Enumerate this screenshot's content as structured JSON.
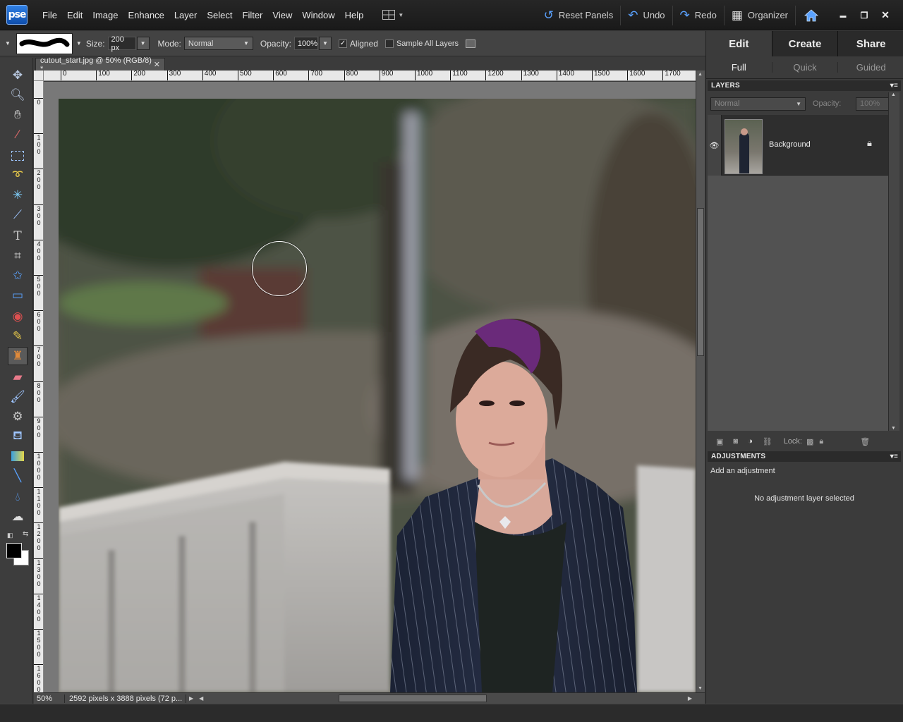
{
  "app": {
    "logo": "pse"
  },
  "menu": [
    "File",
    "Edit",
    "Image",
    "Enhance",
    "Layer",
    "Select",
    "Filter",
    "View",
    "Window",
    "Help"
  ],
  "menu_right": {
    "reset_panels": "Reset Panels",
    "undo": "Undo",
    "redo": "Redo",
    "organizer": "Organizer"
  },
  "window_buttons": {
    "minimize": "▬",
    "restore": "❐",
    "close": "✕"
  },
  "options": {
    "size_label": "Size:",
    "size_value": "200 px",
    "mode_label": "Mode:",
    "mode_value": "Normal",
    "opacity_label": "Opacity:",
    "opacity_value": "100%",
    "aligned_label": "Aligned",
    "aligned_checked": true,
    "sample_all_layers_label": "Sample All Layers",
    "sample_all_layers_checked": false
  },
  "document": {
    "tab_title": "cutout_start.jpg @ 50% (RGB/8) *",
    "hruler_ticks": [
      "0",
      "100",
      "200",
      "300",
      "400",
      "500",
      "600",
      "700",
      "800",
      "900",
      "1000",
      "1100",
      "1200",
      "1300",
      "1400",
      "1500",
      "1600",
      "1700"
    ],
    "vruler_ticks": [
      "0",
      "1 0 0",
      "2 0 0",
      "3 0 0",
      "4 0 0",
      "5 0 0",
      "6 0 0",
      "7 0 0",
      "8 0 0",
      "9 0 0",
      "1 0 0 0",
      "1 1 0 0",
      "1 2 0 0",
      "1 3 0 0",
      "1 4 0 0",
      "1 5 0 0",
      "1 6 0 0"
    ]
  },
  "status": {
    "zoom": "50%",
    "info": "2592 pixels x 3888 pixels (72 p..."
  },
  "right_panel": {
    "mode_tabs": [
      "Edit",
      "Create",
      "Share"
    ],
    "active_mode": "Edit",
    "sub_tabs": [
      "Full",
      "Quick",
      "Guided"
    ],
    "active_sub": "Full",
    "layers": {
      "title": "LAYERS",
      "blend_mode": "Normal",
      "opacity_label": "Opacity:",
      "opacity_value": "100%",
      "lock_label": "Lock:",
      "items": [
        {
          "name": "Background",
          "locked": true,
          "visible": true
        }
      ]
    },
    "adjustments": {
      "title": "ADJUSTMENTS",
      "subtitle": "Add an adjustment",
      "empty_text": "No adjustment layer selected"
    }
  },
  "colors": {
    "accent": "#5aa2ff",
    "panel_bg": "#3b3b3b",
    "menubar_bg": "#1f1f1f"
  },
  "tools": [
    "move-icon",
    "zoom-icon",
    "hand-icon",
    "eyedropper-icon",
    "marquee-icon",
    "lasso-icon",
    "magic-wand-icon",
    "quick-selection-icon",
    "type-icon",
    "crop-icon",
    "cookie-cutter-icon",
    "straighten-icon",
    "red-eye-icon",
    "healing-brush-icon",
    "clone-stamp-icon",
    "eraser-icon",
    "brush-icon",
    "smart-brush-icon",
    "paint-bucket-icon",
    "gradient-icon",
    "line-icon",
    "blur-icon",
    "sponge-icon"
  ]
}
